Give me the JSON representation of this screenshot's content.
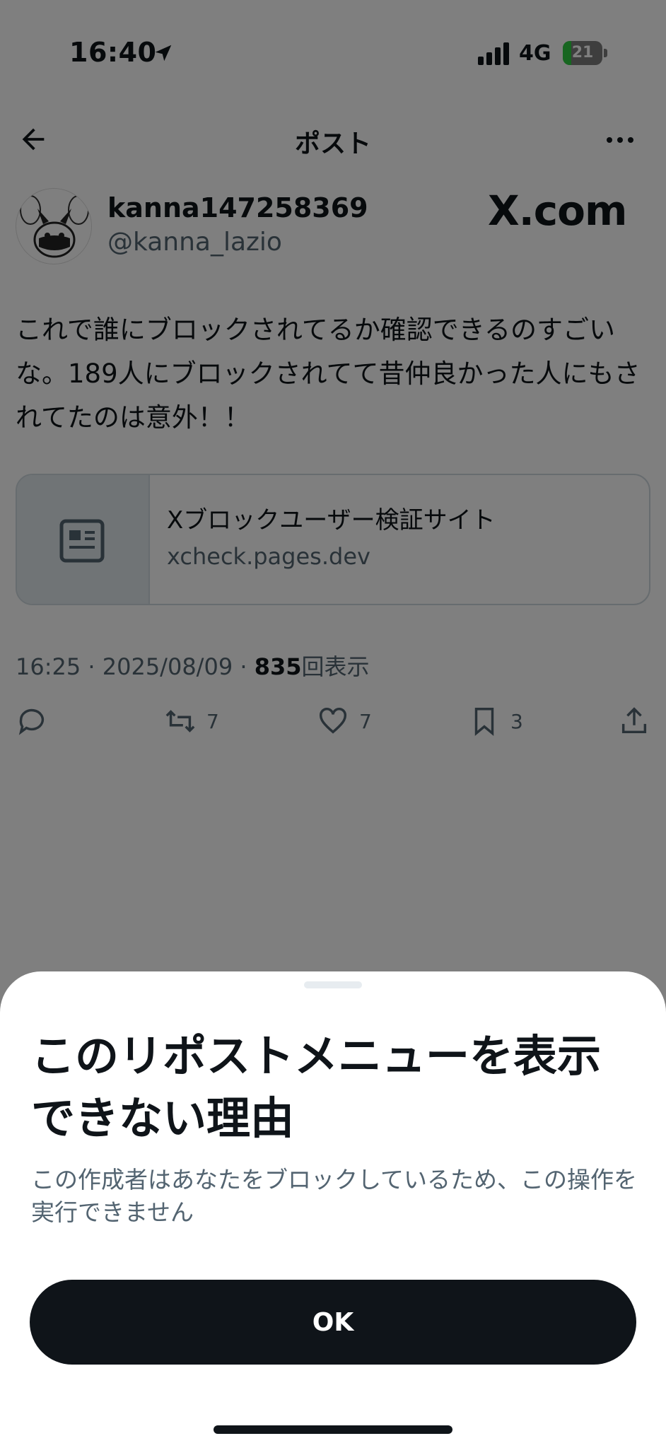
{
  "status_bar": {
    "time": "16:40",
    "network": "4G",
    "battery": "21",
    "battery_level": 0.21
  },
  "header": {
    "title": "ポスト"
  },
  "post": {
    "display_name": "kanna147258369",
    "handle": "@kanna_lazio",
    "watermark": "X.com",
    "text": "これで誰にブロックされてるか確認できるのすごいな。189人にブロックされてて昔仲良かった人にもされてたのは意外！！",
    "card": {
      "title": "Xブロックユーザー検証サイト",
      "domain": "xcheck.pages.dev"
    },
    "meta": {
      "timestamp": "16:25 · 2025/08/09 · ",
      "views": "835",
      "views_label": "回表示"
    },
    "actions": {
      "retweets": "7",
      "likes": "7",
      "bookmarks": "3"
    }
  },
  "sheet": {
    "title": "このリポストメニューを表示できない理由",
    "message": "この作成者はあなたをブロックしているため、この操作を実行できません",
    "ok_label": "OK"
  },
  "colors": {
    "text_primary": "#0f1419",
    "text_secondary": "#536471",
    "button_dark": "#0f1419",
    "battery_green": "#2ecc40"
  }
}
